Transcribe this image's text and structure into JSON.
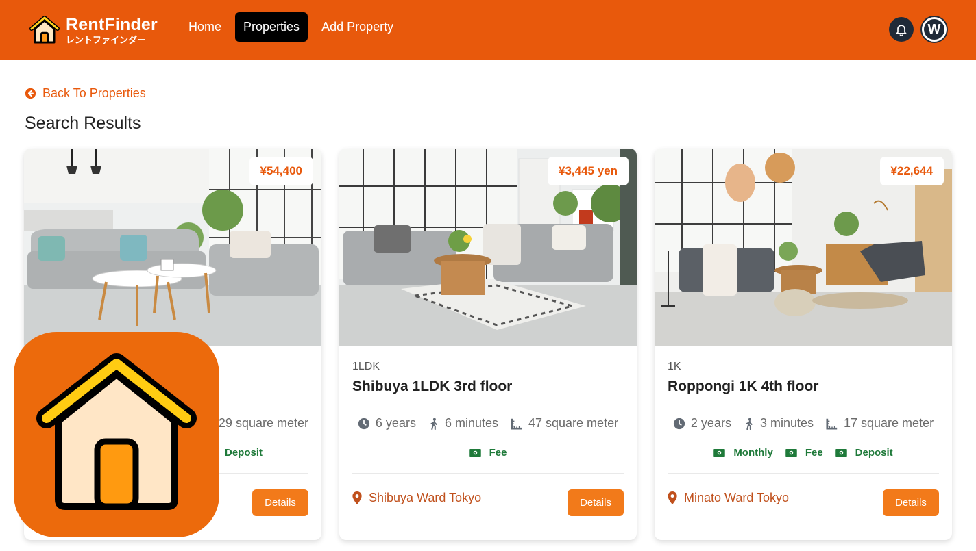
{
  "brand": {
    "name": "RentFinder",
    "tagline": "レントファインダー",
    "logo_icon": "house-icon"
  },
  "nav": [
    {
      "label": "Home",
      "active": false
    },
    {
      "label": "Properties",
      "active": true
    },
    {
      "label": "Add Property",
      "active": false
    }
  ],
  "header": {
    "bell_icon": "bell-icon",
    "avatar_initial": "W"
  },
  "back_label": "Back To Properties",
  "page_title": "Search Results",
  "colors": {
    "accent": "#e8590c",
    "button": "#f27a1a",
    "tag_green": "#1f7a3a",
    "location": "#c0501c"
  },
  "cards": [
    {
      "price": "¥54,400",
      "type": "",
      "name": "",
      "specs": {
        "age": "",
        "walk": "",
        "area": "29 square meter"
      },
      "tags": [
        "Deposit"
      ],
      "location": "",
      "details_label": "Details"
    },
    {
      "price": "¥3,445 yen",
      "type": "1LDK",
      "name": "Shibuya 1LDK 3rd floor",
      "specs": {
        "age": "6 years",
        "walk": "6 minutes",
        "area": "47 square meter"
      },
      "tags": [
        "Fee"
      ],
      "location": "Shibuya Ward Tokyo",
      "details_label": "Details"
    },
    {
      "price": "¥22,644",
      "type": "1K",
      "name": "Roppongi 1K 4th floor",
      "specs": {
        "age": "2 years",
        "walk": "3 minutes",
        "area": "17 square meter"
      },
      "tags": [
        "Monthly",
        "Fee",
        "Deposit"
      ],
      "location": "Minato Ward Tokyo",
      "details_label": "Details"
    }
  ],
  "overlay_icon": "app-house-icon"
}
